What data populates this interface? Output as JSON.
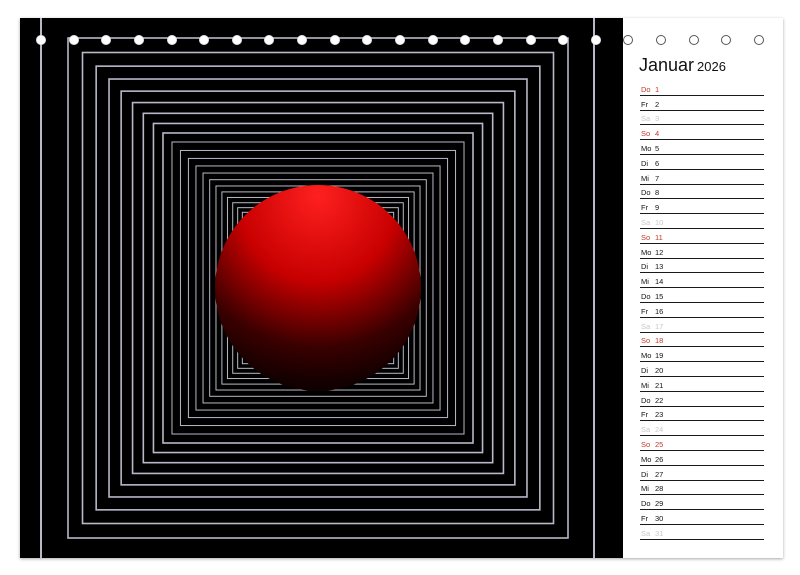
{
  "calendar": {
    "month": "Januar",
    "year": "2026",
    "days": [
      {
        "dn": "Do",
        "dd": "1",
        "type": "sun"
      },
      {
        "dn": "Fr",
        "dd": "2",
        "type": "work"
      },
      {
        "dn": "Sa",
        "dd": "3",
        "type": "sat"
      },
      {
        "dn": "So",
        "dd": "4",
        "type": "sun"
      },
      {
        "dn": "Mo",
        "dd": "5",
        "type": "work"
      },
      {
        "dn": "Di",
        "dd": "6",
        "type": "work"
      },
      {
        "dn": "Mi",
        "dd": "7",
        "type": "work"
      },
      {
        "dn": "Do",
        "dd": "8",
        "type": "work"
      },
      {
        "dn": "Fr",
        "dd": "9",
        "type": "work"
      },
      {
        "dn": "Sa",
        "dd": "10",
        "type": "sat"
      },
      {
        "dn": "So",
        "dd": "11",
        "type": "sun"
      },
      {
        "dn": "Mo",
        "dd": "12",
        "type": "work"
      },
      {
        "dn": "Di",
        "dd": "13",
        "type": "work"
      },
      {
        "dn": "Mi",
        "dd": "14",
        "type": "work"
      },
      {
        "dn": "Do",
        "dd": "15",
        "type": "work"
      },
      {
        "dn": "Fr",
        "dd": "16",
        "type": "work"
      },
      {
        "dn": "Sa",
        "dd": "17",
        "type": "sat"
      },
      {
        "dn": "So",
        "dd": "18",
        "type": "sun"
      },
      {
        "dn": "Mo",
        "dd": "19",
        "type": "work"
      },
      {
        "dn": "Di",
        "dd": "20",
        "type": "work"
      },
      {
        "dn": "Mi",
        "dd": "21",
        "type": "work"
      },
      {
        "dn": "Do",
        "dd": "22",
        "type": "work"
      },
      {
        "dn": "Fr",
        "dd": "23",
        "type": "work"
      },
      {
        "dn": "Sa",
        "dd": "24",
        "type": "sat"
      },
      {
        "dn": "So",
        "dd": "25",
        "type": "sun"
      },
      {
        "dn": "Mo",
        "dd": "26",
        "type": "work"
      },
      {
        "dn": "Di",
        "dd": "27",
        "type": "work"
      },
      {
        "dn": "Mi",
        "dd": "28",
        "type": "work"
      },
      {
        "dn": "Do",
        "dd": "29",
        "type": "work"
      },
      {
        "dn": "Fr",
        "dd": "30",
        "type": "work"
      },
      {
        "dn": "Sa",
        "dd": "31",
        "type": "sat"
      }
    ]
  },
  "image": {
    "subject": "red-sphere-in-square-tunnel",
    "sphere_color": "#e00000",
    "background_color": "#000000",
    "frame_line_color": "#b8b8c8"
  },
  "colors": {
    "sunday_holiday": "#c0392b",
    "saturday": "#c8c8c8",
    "text": "#111111"
  },
  "binding": {
    "ring_count": 23
  }
}
